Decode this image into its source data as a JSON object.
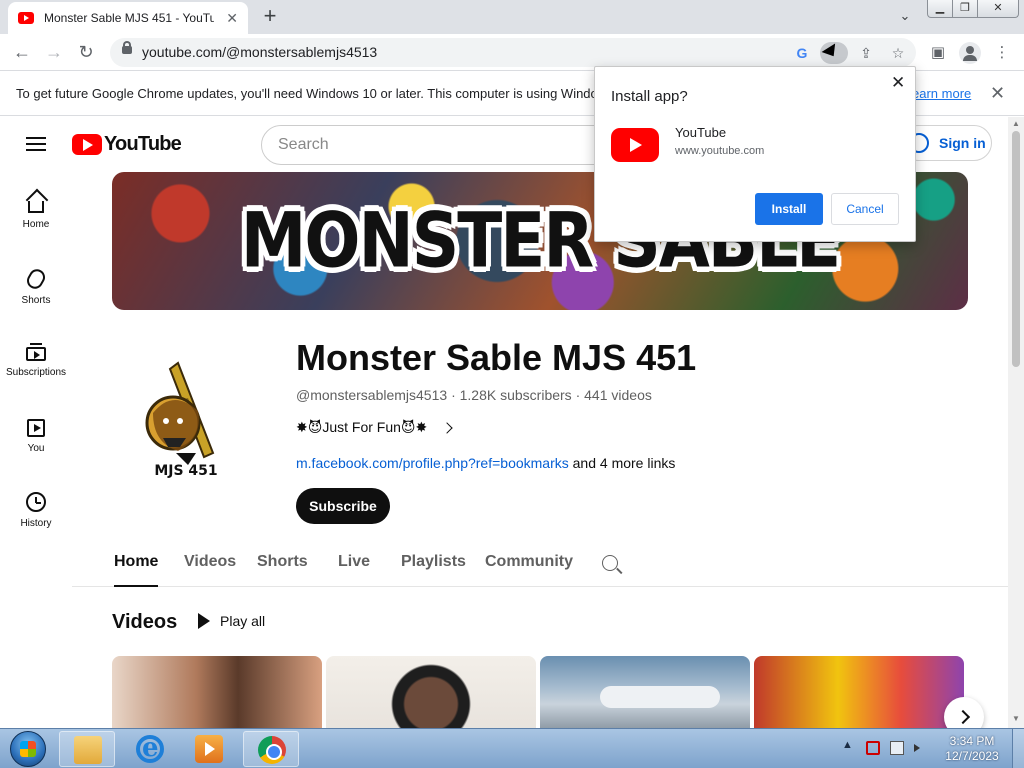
{
  "browser": {
    "tab_title": "Monster Sable MJS 451 - YouTube",
    "tab_close": "✕",
    "new_tab": "+",
    "tab_search": "⌄",
    "url": "youtube.com/@monstersablemjs4513",
    "window_min": "▁",
    "window_max": "❐",
    "window_close": "✕",
    "back": "←",
    "forward": "→",
    "reload": "↻",
    "g_label": "G",
    "share": "⇪",
    "star": "☆",
    "sidepanel": "▣",
    "menu": "⋮"
  },
  "infobar": {
    "message": "To get future Google Chrome updates, you'll need Windows 10 or later. This computer is using Windo",
    "learn_more": "earn more",
    "close": "✕"
  },
  "youtube": {
    "logo_text": "YouTube",
    "search_placeholder": "Search",
    "sign_in": "Sign in",
    "nav": [
      {
        "label": "Home"
      },
      {
        "label": "Shorts"
      },
      {
        "label": "Subscriptions"
      },
      {
        "label": "You"
      },
      {
        "label": "History"
      }
    ],
    "banner_text": "MONSTER SABLE",
    "channel": {
      "name": "Monster Sable MJS 451",
      "handle": "@monstersablemjs4513",
      "subscribers": "1.28K subscribers",
      "videos": "441 videos",
      "separator": "·",
      "description": "✸😈Just For Fun😈✸",
      "link": "m.facebook.com/profile.php?ref=bookmarks",
      "more_links": " and 4 more links",
      "subscribe": "Subscribe",
      "avatar_text": "MJS 451"
    },
    "tabs": [
      "Home",
      "Videos",
      "Shorts",
      "Live",
      "Playlists",
      "Community"
    ],
    "section_title": "Videos",
    "play_all": "Play all"
  },
  "dialog": {
    "title": "Install app?",
    "close": "✕",
    "app_name": "YouTube",
    "app_url": "www.youtube.com",
    "install": "Install",
    "cancel": "Cancel"
  },
  "taskbar": {
    "tray_arrow": "▲",
    "time": "3:34 PM",
    "date": "12/7/2023"
  }
}
